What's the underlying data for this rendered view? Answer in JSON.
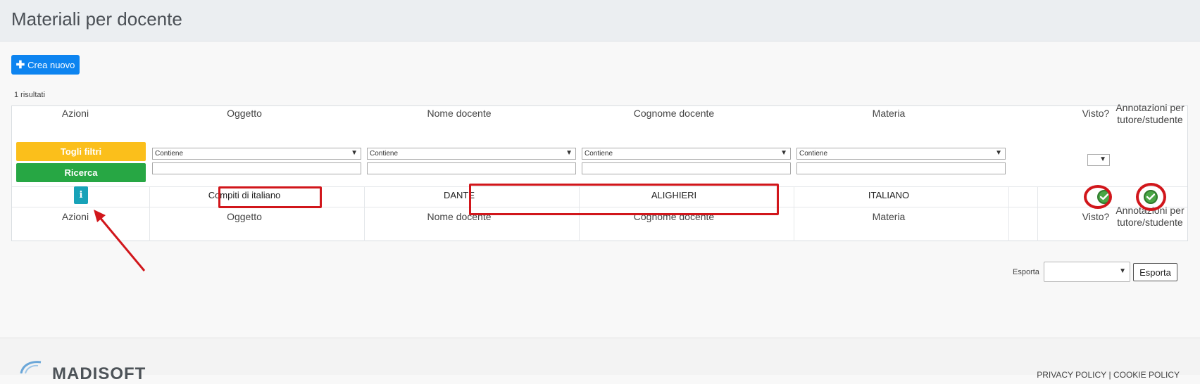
{
  "page": {
    "title": "Materiali per docente"
  },
  "toolbar": {
    "create_label": "Crea nuovo"
  },
  "results": {
    "count_label": "1 risultati"
  },
  "table": {
    "columns": [
      "Azioni",
      "Oggetto",
      "Nome docente",
      "Cognome docente",
      "Materia",
      "Visto?",
      "Annotazioni per tutore/studente"
    ],
    "filters": {
      "clear_label": "Togli filtri",
      "search_label": "Ricerca",
      "operator": "Contiene"
    },
    "rows": [
      {
        "oggetto": "Compiti di italiano",
        "nome": "DANTE",
        "cognome": "ALIGHIERI",
        "materia": "ITALIANO",
        "visto": true,
        "annotazioni": true
      }
    ]
  },
  "export": {
    "label": "Esporta",
    "button": "Esporta",
    "selected": ""
  },
  "footer": {
    "brand": "MADISOFT",
    "privacy": "PRIVACY POLICY",
    "separator": "|",
    "cookie": "COOKIE POLICY"
  },
  "colors": {
    "primary": "#0d84f0",
    "warning": "#fbbf1b",
    "success": "#27a744",
    "info": "#17a2b8",
    "highlight": "#d1161b"
  }
}
